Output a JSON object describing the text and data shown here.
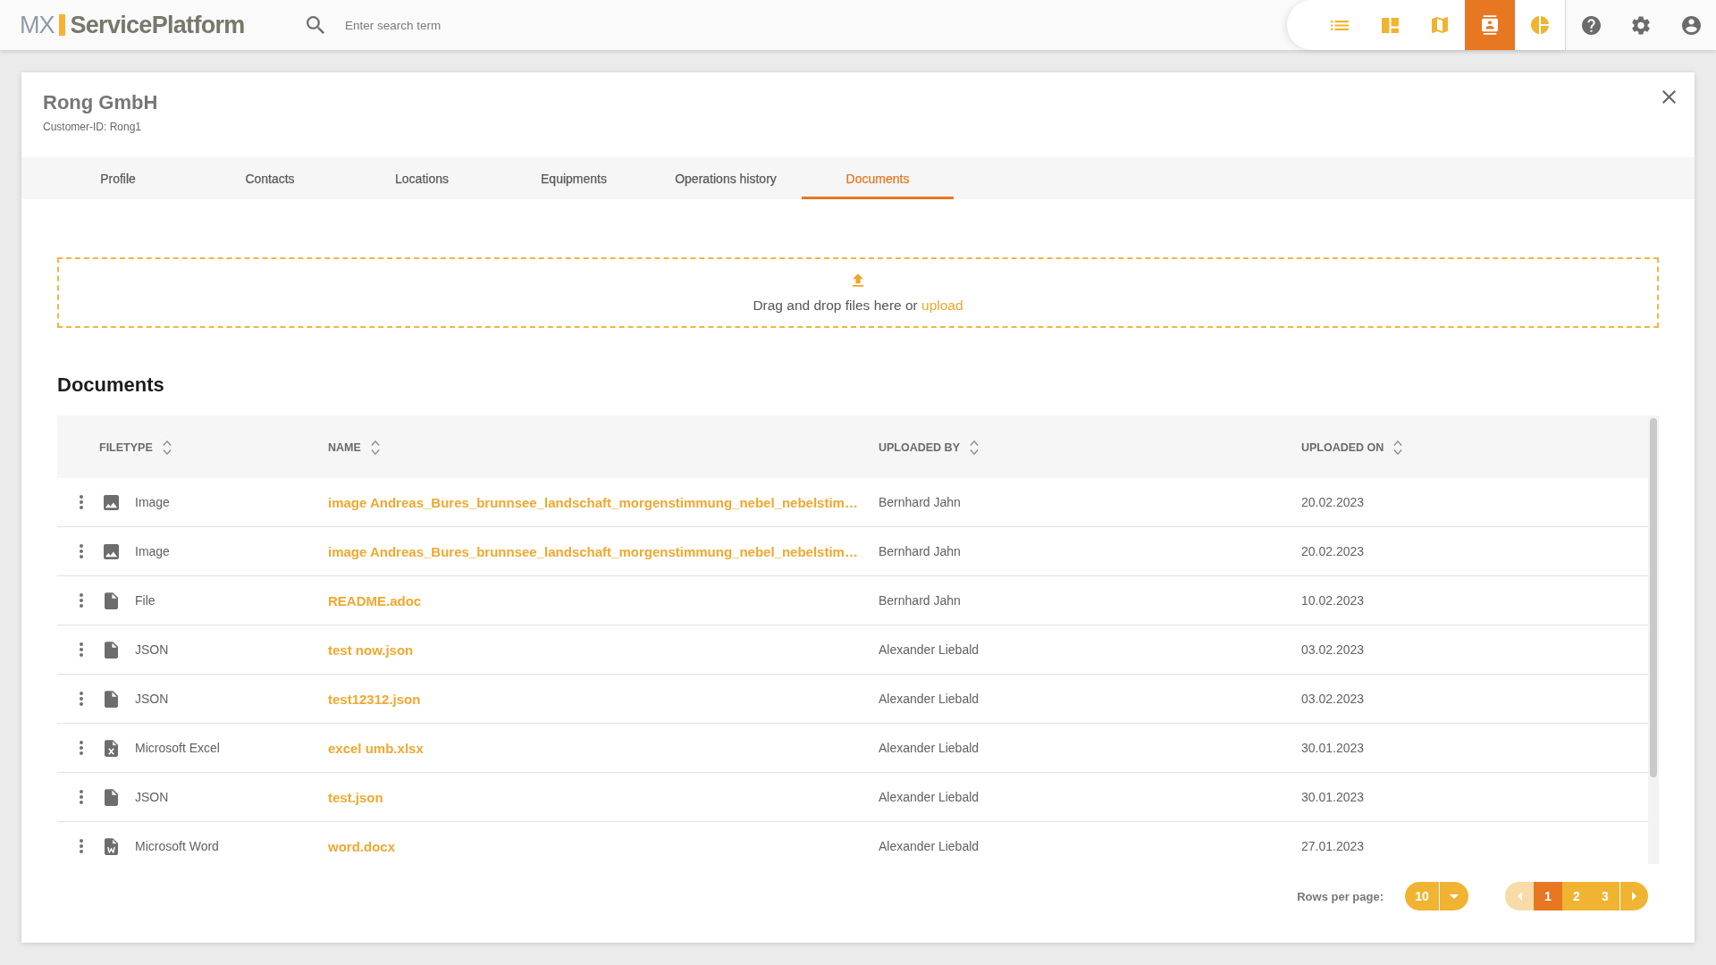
{
  "top_bar": {
    "logo": {
      "prefix": "MX",
      "name": "ServicePlatform"
    },
    "search": {
      "placeholder": "Enter search term"
    },
    "nav": [
      {
        "kind": "list",
        "selected": false
      },
      {
        "kind": "dashboard",
        "selected": false
      },
      {
        "kind": "map",
        "selected": false
      },
      {
        "kind": "contacts",
        "selected": true
      },
      {
        "kind": "chart",
        "selected": false
      }
    ],
    "tools": [
      {
        "kind": "help"
      },
      {
        "kind": "settings"
      },
      {
        "kind": "account"
      }
    ]
  },
  "customer": {
    "name": "Rong GmbH",
    "customer_id": "Customer-ID: Rong1"
  },
  "tabs": [
    {
      "label": "Profile",
      "selected": false
    },
    {
      "label": "Contacts",
      "selected": false
    },
    {
      "label": "Locations",
      "selected": false
    },
    {
      "label": "Equipments",
      "selected": false
    },
    {
      "label": "Operations history",
      "selected": false
    },
    {
      "label": "Documents",
      "selected": true
    }
  ],
  "upload_zone": {
    "text": "Drag and drop files here or",
    "link": "upload"
  },
  "documents": {
    "title": "Documents",
    "columns": [
      {
        "label": "FILETYPE",
        "sortable": true
      },
      {
        "label": "NAME",
        "sortable": true
      },
      {
        "label": "UPLOADED BY",
        "sortable": true
      },
      {
        "label": "UPLOADED ON",
        "sortable": true
      }
    ],
    "rows": [
      {
        "kind": "image",
        "filetype": "Image",
        "name": "image Andreas_Bures_brunnsee_landschaft_morgenstimmung_nebel_nebelstim…",
        "uploaded_by": "Bernhard Jahn",
        "uploaded_on": "20.02.2023"
      },
      {
        "kind": "image",
        "filetype": "Image",
        "name": "image Andreas_Bures_brunnsee_landschaft_morgenstimmung_nebel_nebelstim…",
        "uploaded_by": "Bernhard Jahn",
        "uploaded_on": "20.02.2023"
      },
      {
        "kind": "file",
        "filetype": "File",
        "name": "README.adoc",
        "uploaded_by": "Bernhard Jahn",
        "uploaded_on": "10.02.2023"
      },
      {
        "kind": "file",
        "filetype": "JSON",
        "name": "test now.json",
        "uploaded_by": "Alexander Liebald",
        "uploaded_on": "03.02.2023"
      },
      {
        "kind": "file",
        "filetype": "JSON",
        "name": "test12312.json",
        "uploaded_by": "Alexander Liebald",
        "uploaded_on": "03.02.2023"
      },
      {
        "kind": "excel",
        "filetype": "Microsoft Excel",
        "name": "excel umb.xlsx",
        "uploaded_by": "Alexander Liebald",
        "uploaded_on": "30.01.2023"
      },
      {
        "kind": "file",
        "filetype": "JSON",
        "name": "test.json",
        "uploaded_by": "Alexander Liebald",
        "uploaded_on": "30.01.2023"
      },
      {
        "kind": "word",
        "filetype": "Microsoft Word",
        "name": "word.docx",
        "uploaded_by": "Alexander Liebald",
        "uploaded_on": "27.01.2023"
      }
    ],
    "pagination": {
      "rows_per_page_label": "Rows per page:",
      "rows_per_page": "10",
      "prev_disabled": true,
      "next_disabled": false,
      "pages": [
        {
          "label": "1",
          "selected": true
        },
        {
          "label": "2",
          "selected": false
        },
        {
          "label": "3",
          "selected": false
        }
      ]
    }
  }
}
